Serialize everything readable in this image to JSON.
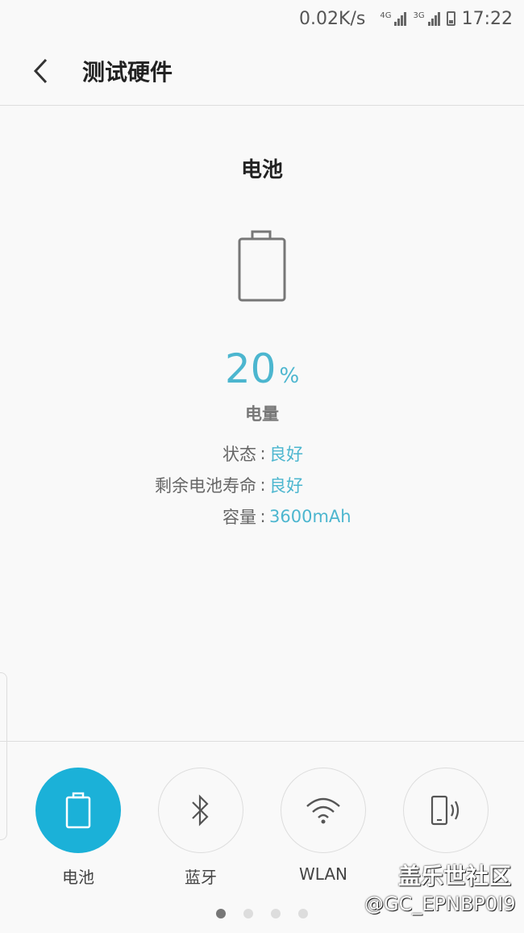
{
  "status_bar": {
    "net_speed": "0.02K/s",
    "sim1_type": "4G",
    "sim2_type": "3G",
    "time": "17:22"
  },
  "app_bar": {
    "title": "测试硬件"
  },
  "battery": {
    "section_title": "电池",
    "percent_value": "20",
    "percent_unit": "%",
    "level_label": "电量",
    "details": [
      {
        "label": "状态",
        "separator": ":",
        "value": "良好"
      },
      {
        "label": "剩余电池寿命",
        "separator": ":",
        "value": "良好"
      },
      {
        "label": "容量",
        "separator": ":",
        "value": "3600mAh"
      }
    ],
    "accent_color": "#4cb6cf"
  },
  "tabs": [
    {
      "label": "电池",
      "icon": "battery-icon",
      "active": true
    },
    {
      "label": "蓝牙",
      "icon": "bluetooth-icon",
      "active": false
    },
    {
      "label": "WLAN",
      "icon": "wifi-icon",
      "active": false
    },
    {
      "label": "",
      "icon": "phone-vibrate-icon",
      "active": false
    }
  ],
  "page_indicator": {
    "count": 4,
    "current": 1
  },
  "watermark": {
    "line1": "盖乐世社区",
    "line2": "@GC_EPNBP0I9"
  }
}
